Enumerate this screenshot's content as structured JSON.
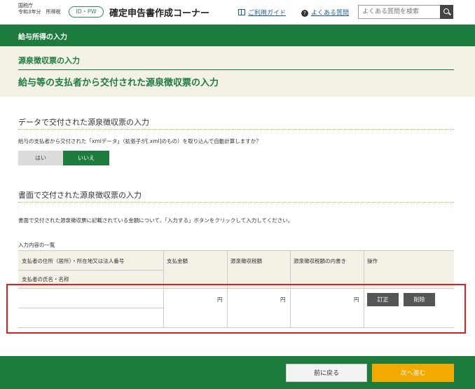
{
  "header": {
    "agency": "国税庁",
    "year_form": "令和3年分　所得税",
    "id_pill": "ID・PW",
    "site_title": "確定申告書作成コーナー",
    "guide_link": "ご利用ガイド",
    "faq_link": "よくある質問",
    "faq_icon_text": "?",
    "search_placeholder": "よくある質問を検索"
  },
  "section_bar": {
    "label": "給与所得の入力"
  },
  "title_area": {
    "sub_title": "源泉徴収票の入力",
    "main_title": "給与等の支払者から交付された源泉徴収票の入力"
  },
  "data_section": {
    "heading": "データで交付された源泉徴収票の入力",
    "question": "給与の支払者から交付された「xmlデータ」（拡張子が[.xml]のもの）を取り込んで自動計算しますか？",
    "yes_label": "はい",
    "no_label": "いいえ"
  },
  "paper_section": {
    "heading": "書面で交付された源泉徴収票の入力",
    "description": "書面で交付された源泉徴収票に記載されている金額について、「入力する」ボタンをクリックして入力してください。",
    "list_label": "入力内容の一覧"
  },
  "table": {
    "headers": {
      "payer_address": "支払者の住所（居所）・所在地又は法人番号",
      "payer_name": "支払者の氏名・名称",
      "amount": "支払金額",
      "withholding": "源泉徴収税額",
      "withholding_detail": "源泉徴収税額の内書き",
      "operation": "操作"
    },
    "row": {
      "amount_unit": "円",
      "withholding_unit": "円",
      "detail_unit": "円",
      "edit_label": "訂正",
      "delete_label": "削除"
    }
  },
  "footer": {
    "back_label": "前に戻る",
    "next_label": "次へ進む"
  },
  "colors": {
    "brand_green": "#1e7b3e",
    "beige": "#f3f0e6",
    "next_orange": "#f2a900",
    "highlight_red": "#e02020"
  }
}
